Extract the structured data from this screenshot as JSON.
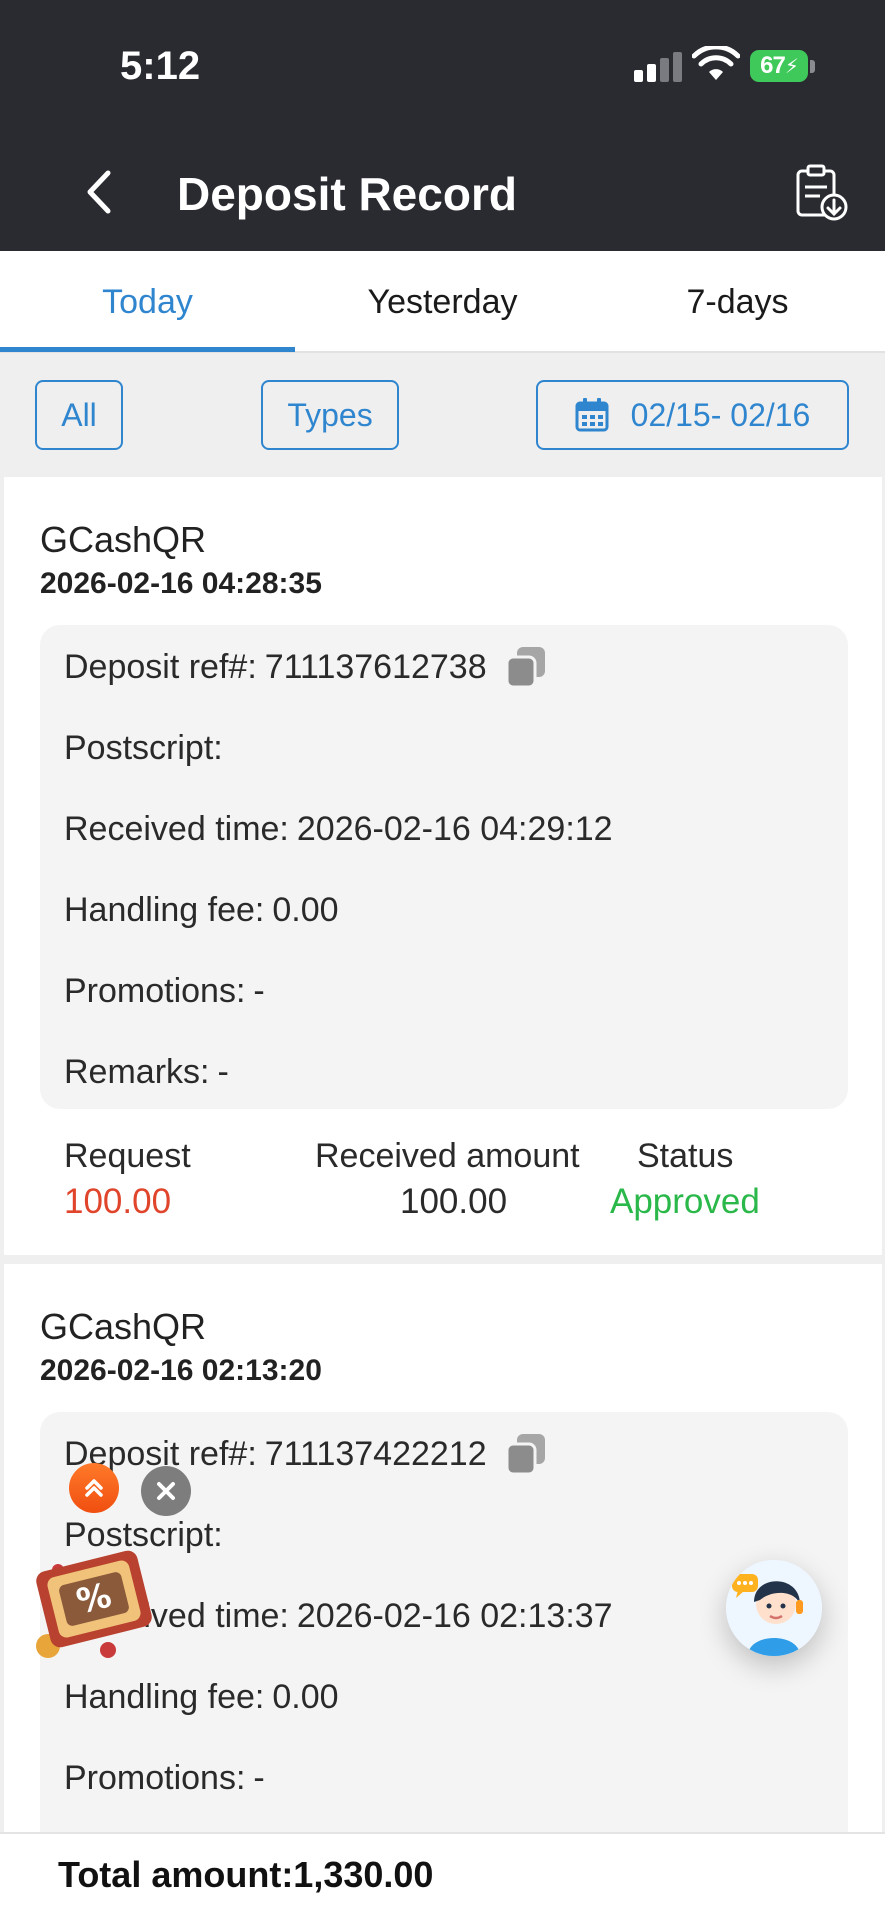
{
  "status_bar": {
    "time": "5:12",
    "battery": "67",
    "icons": [
      "cellular-signal-icon",
      "wifi-icon",
      "battery-charging-icon"
    ]
  },
  "header": {
    "title": "Deposit Record",
    "back_icon": "chevron-left-icon",
    "action_icon": "clipboard-download-icon"
  },
  "tabs": [
    {
      "label": "Today",
      "active": true
    },
    {
      "label": "Yesterday",
      "active": false
    },
    {
      "label": "7-days",
      "active": false
    }
  ],
  "filters": {
    "all_label": "All",
    "types_label": "Types",
    "date_range": "02/15- 02/16",
    "date_icon": "calendar-icon"
  },
  "records": [
    {
      "method": "GCashQR",
      "datetime": "2026-02-16 04:28:35",
      "details": [
        {
          "label": "Deposit ref#:",
          "value": "711137612738"
        },
        {
          "label": "Postscript:",
          "value": ""
        },
        {
          "label": "Received time:",
          "value": "2026-02-16 04:29:12"
        },
        {
          "label": "Handling fee:",
          "value": "0.00"
        },
        {
          "label": "Promotions:",
          "value": "-"
        },
        {
          "label": "Remarks:",
          "value": "-"
        }
      ],
      "summary": {
        "request_label": "Request",
        "request_value": "100.00",
        "received_label": "Received amount",
        "received_value": "100.00",
        "status_label": "Status",
        "status_value": "Approved"
      }
    },
    {
      "method": "GCashQR",
      "datetime": "2026-02-16 02:13:20",
      "details": [
        {
          "label": "Deposit ref#:",
          "value": "711137422212"
        },
        {
          "label": "Postscript:",
          "value": ""
        },
        {
          "label": "Received time:",
          "value": "2026-02-16 02:13:37"
        },
        {
          "label": "Handling fee:",
          "value": "0.00"
        },
        {
          "label": "Promotions:",
          "value": "-"
        }
      ]
    }
  ],
  "footer": {
    "total": "Total amount:1,330.00"
  },
  "colors": {
    "header_bg": "#2a2b30",
    "accent": "#2f86cf",
    "request_amount": "#e0452c",
    "status_approved": "#2bb84a",
    "detail_bg": "#f4f4f4"
  }
}
